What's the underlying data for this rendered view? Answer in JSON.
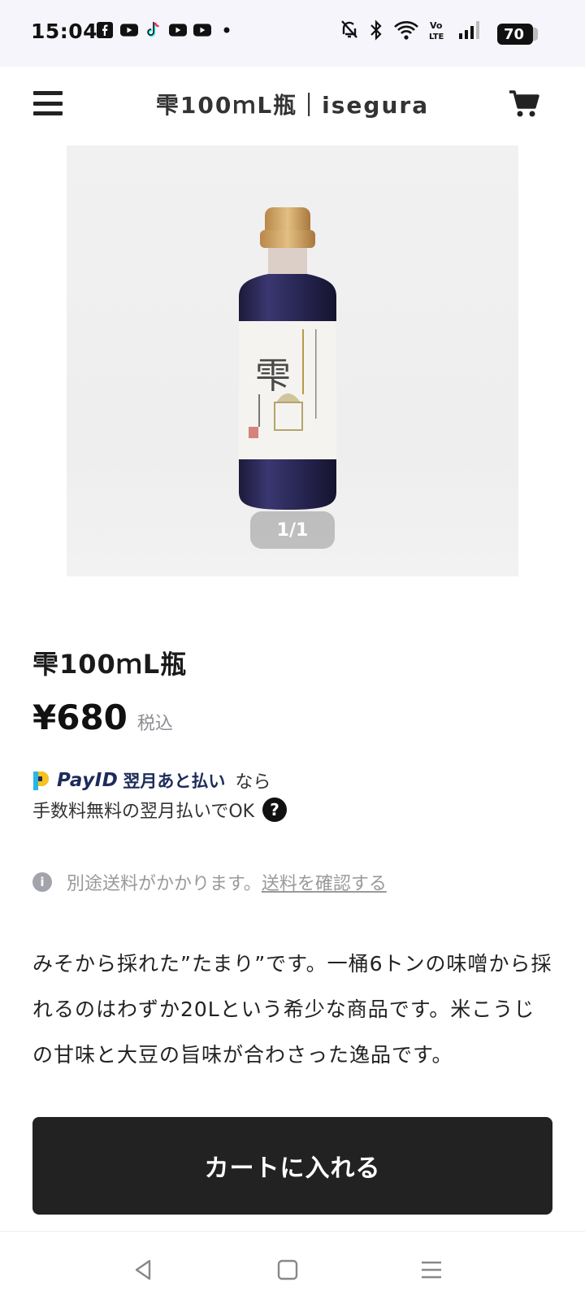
{
  "status_bar": {
    "time": "15:04",
    "battery": "70",
    "left_icons": [
      "facebook-icon",
      "youtube-icon",
      "tiktok-icon",
      "youtube-icon",
      "youtube-icon",
      "dot-icon"
    ],
    "right_icons": [
      "mute-bell-icon",
      "bluetooth-icon",
      "wifi-icon",
      "volte-icon",
      "signal-icon",
      "battery-icon"
    ]
  },
  "header": {
    "title": "雫100ｍL瓶｜isegura",
    "menu_icon": "hamburger-menu-icon",
    "cart_icon": "shopping-cart-icon"
  },
  "gallery": {
    "counter": "1/1"
  },
  "product": {
    "name": "雫100ｍL瓶",
    "price": "¥680",
    "tax_label": "税込"
  },
  "payid": {
    "brand": "PayID",
    "service": "翌月あと払い",
    "suffix": "なら",
    "line2": "手数料無料の翌月払いでOK",
    "help_symbol": "?"
  },
  "shipping": {
    "info_symbol": "i",
    "text": "別途送料がかかります。",
    "link": "送料を確認する"
  },
  "description": {
    "text": "みそから採れた”たまり”です。一桶6トンの味噌から採れるのはわずか20Lという希少な商品です。米こうじの甘味と大豆の旨味が合わさった逸品です。"
  },
  "actions": {
    "add_to_cart": "カートに入れる"
  },
  "colors": {
    "button_bg": "#222222",
    "status_bar_bg": "#f6f5fb",
    "payid_navy": "#1d2c5a",
    "muted_text": "#999999"
  }
}
